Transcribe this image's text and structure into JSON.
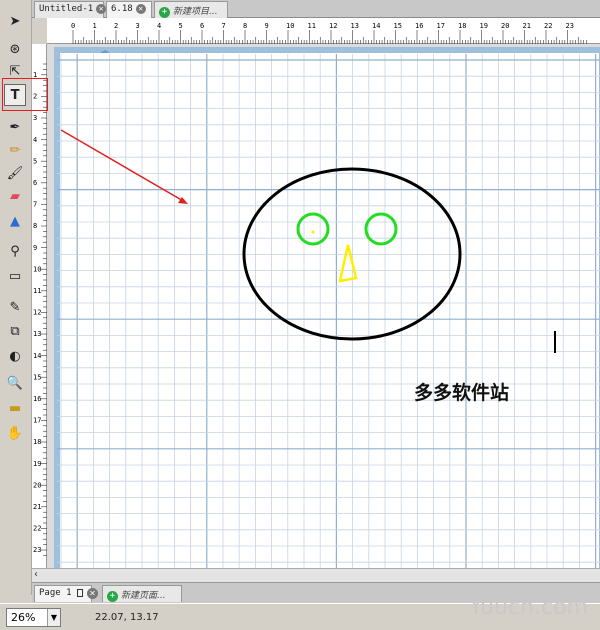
{
  "tabs": [
    {
      "label": "Untitled-1",
      "closable": true
    },
    {
      "label": "6.18",
      "closable": true
    },
    {
      "label": "新建项目...",
      "new": true
    }
  ],
  "tools": [
    {
      "name": "pointer-tool-icon",
      "glyph": "➤"
    },
    {
      "name": "subselect-tool-icon",
      "glyph": "⊛"
    },
    {
      "name": "lasso-tool-icon",
      "glyph": "⇱"
    },
    {
      "name": "text-tool-icon",
      "glyph": "T"
    },
    {
      "name": "pen-tool-icon",
      "glyph": "✒"
    },
    {
      "name": "pencil-tool-icon",
      "glyph": "✏"
    },
    {
      "name": "brush-tool-icon",
      "glyph": "🖌"
    },
    {
      "name": "eraser-tool-icon",
      "glyph": "▰"
    },
    {
      "name": "paint-bucket-tool-icon",
      "glyph": "▲"
    },
    {
      "name": "eyedropper-tool-icon",
      "glyph": "⚲"
    },
    {
      "name": "rectangle-tool-icon",
      "glyph": "▭"
    },
    {
      "name": "knife-tool-icon",
      "glyph": "✎"
    },
    {
      "name": "transform-tool-icon",
      "glyph": "⧉"
    },
    {
      "name": "perspective-tool-icon",
      "glyph": "◐"
    },
    {
      "name": "zoom-tool-icon",
      "glyph": "🔍"
    },
    {
      "name": "measure-tool-icon",
      "glyph": "▬"
    },
    {
      "name": "hand-tool-icon",
      "glyph": "✋"
    }
  ],
  "ruler_top_labels": [
    "0",
    "1",
    "2",
    "3",
    "4",
    "5",
    "6",
    "7",
    "8",
    "9",
    "10",
    "11",
    "12",
    "13",
    "14",
    "15",
    "16",
    "17",
    "18",
    "19",
    "20",
    "21",
    "22",
    "23"
  ],
  "ruler_left_labels": [
    "1",
    "2",
    "3",
    "4",
    "5",
    "6",
    "7",
    "8",
    "9",
    "10",
    "11",
    "12",
    "13",
    "14",
    "15",
    "16",
    "17",
    "18",
    "19",
    "20",
    "21",
    "22",
    "23"
  ],
  "canvas_text": "多多软件站",
  "page_tab": {
    "label": "Page 1",
    "new_label": "新建页面..."
  },
  "status": {
    "zoom": "26%",
    "coords": "22.07, 13.17"
  },
  "watermark": "Yuucn.com",
  "colors": {
    "face": "#000000",
    "eyes": "#22dd22",
    "nose": "#ffee00",
    "highlight": "#e02020",
    "grid": "#c4d4e4",
    "grid_major": "#8fb0cc"
  }
}
